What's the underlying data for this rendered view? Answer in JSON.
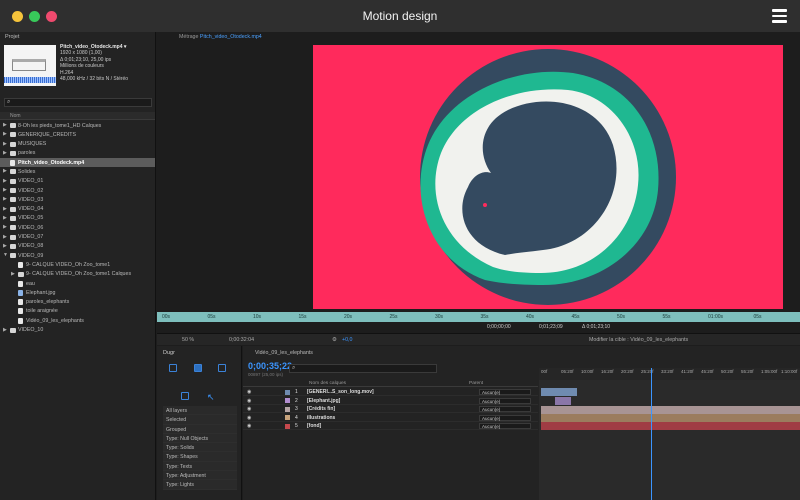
{
  "app": {
    "title": "Motion design"
  },
  "colors": {
    "accent": "#3b95ff",
    "comp_bg": "#ff2a5c",
    "teal": "#1fb891",
    "navy": "#344a60",
    "off_white": "#f1f2ee"
  },
  "project": {
    "title": "Projet",
    "file": {
      "name": "Pitch_video_Otodeck.mp4 ▾",
      "lines": [
        "1920 x 1080 (1,00)",
        "Δ 0;01;23;10, 25,00 ips",
        "Millions de couleurs",
        "H.264",
        "48,000 kHz / 32 bits N / Stéréo"
      ]
    },
    "search_icon": "search-icon",
    "column": "Nom",
    "items": [
      {
        "label": "8-Oh les pieds_tome1_HD Calques",
        "type": "folder",
        "indent": 0,
        "expanded": false
      },
      {
        "label": "GENERIQUE_CREDITS",
        "type": "folder",
        "indent": 0,
        "expanded": false
      },
      {
        "label": "MUSIQUES",
        "type": "folder",
        "indent": 0,
        "expanded": false
      },
      {
        "label": "paroles",
        "type": "folder",
        "indent": 0,
        "expanded": false
      },
      {
        "label": "Pitch_video_Otodeck.mp4",
        "type": "file",
        "indent": 0,
        "selected": true
      },
      {
        "label": "Solides",
        "type": "folder",
        "indent": 0,
        "expanded": false
      },
      {
        "label": "VIDEO_01",
        "type": "folder",
        "indent": 0,
        "expanded": false
      },
      {
        "label": "VIDEO_02",
        "type": "folder",
        "indent": 0,
        "expanded": false
      },
      {
        "label": "VIDEO_03",
        "type": "folder",
        "indent": 0,
        "expanded": false
      },
      {
        "label": "VIDEO_04",
        "type": "folder",
        "indent": 0,
        "expanded": false
      },
      {
        "label": "VIDEO_05",
        "type": "folder",
        "indent": 0,
        "expanded": false
      },
      {
        "label": "VIDEO_06",
        "type": "folder",
        "indent": 0,
        "expanded": false
      },
      {
        "label": "VIDEO_07",
        "type": "folder",
        "indent": 0,
        "expanded": false
      },
      {
        "label": "VIDEO_08",
        "type": "folder",
        "indent": 0,
        "expanded": false
      },
      {
        "label": "VIDEO_09",
        "type": "folder",
        "indent": 0,
        "expanded": true
      },
      {
        "label": "9- CALQUE VIDEO_Oh Zoo_tome1",
        "type": "file",
        "indent": 1
      },
      {
        "label": "9- CALQUE VIDEO_Oh Zoo_tome1 Calques",
        "type": "folder",
        "indent": 1,
        "expanded": false
      },
      {
        "label": "eau",
        "type": "file",
        "indent": 1
      },
      {
        "label": "Elephant.jpg",
        "type": "img",
        "indent": 1
      },
      {
        "label": "paroles_elephants",
        "type": "file",
        "indent": 1
      },
      {
        "label": "toile araignée",
        "type": "file",
        "indent": 1
      },
      {
        "label": "Vidéo_09_les_elephants",
        "type": "file",
        "indent": 1
      },
      {
        "label": "VIDEO_10",
        "type": "folder",
        "indent": 0,
        "expanded": false
      }
    ]
  },
  "viewer": {
    "tab_prefix": "Métrage",
    "tab_name": "Pitch_video_Otodeck.mp4",
    "ruler": [
      "00s",
      "05s",
      "10s",
      "15s",
      "20s",
      "25s",
      "30s",
      "35s",
      "40s",
      "45s",
      "50s",
      "55s",
      "01:00s",
      "05s"
    ],
    "status": {
      "in": "0;00;00;00",
      "out": "0;01;23;09",
      "dur": "Δ 0;01;23;10",
      "target": "Modifier la cible : Vidéo_09_les_elephants",
      "offset": "+0,0",
      "zoom": "50 %",
      "time": "0;00:32:04"
    }
  },
  "dugr": {
    "title": "Dugr",
    "list": [
      "All layers",
      "Selected",
      "Grouped",
      "Type: Null Objects",
      "Type: Solids",
      "Type: Shapes",
      "Type: Texts",
      "Type: Adjustment",
      "Type: Lights"
    ]
  },
  "timeline": {
    "tab": "Vidéo_09_les_elephants",
    "time": "0;00;35;22",
    "fps": "00897 (25,00 ips)",
    "col_label": "Nom des calques",
    "col_parent": "Parent",
    "ruler": [
      "00f",
      "05:20f",
      "10:00f",
      "16:20f",
      "20:20f",
      "25:20f",
      "33:20f",
      "41:20f",
      "45:20f",
      "50:20f",
      "55:20f",
      "1:05:00f",
      "1:10:00f"
    ],
    "layers": [
      {
        "num": "1",
        "name": "[GENERI...S_son_long.mov]",
        "color": "#6f8bb0",
        "parent": "Aucun(e)"
      },
      {
        "num": "2",
        "name": "[Elephant.jpg]",
        "color": "#b28dcf",
        "parent": "Aucun(e)"
      },
      {
        "num": "3",
        "name": "[Crédits fin]",
        "color": "#b5a5a5",
        "parent": "Aucun(e)"
      },
      {
        "num": "4",
        "name": "illustrations",
        "color": "#c8a37c",
        "parent": "Aucun(e)"
      },
      {
        "num": "5",
        "name": "[fond]",
        "color": "#c5484d",
        "parent": "Aucun(e)"
      }
    ]
  }
}
